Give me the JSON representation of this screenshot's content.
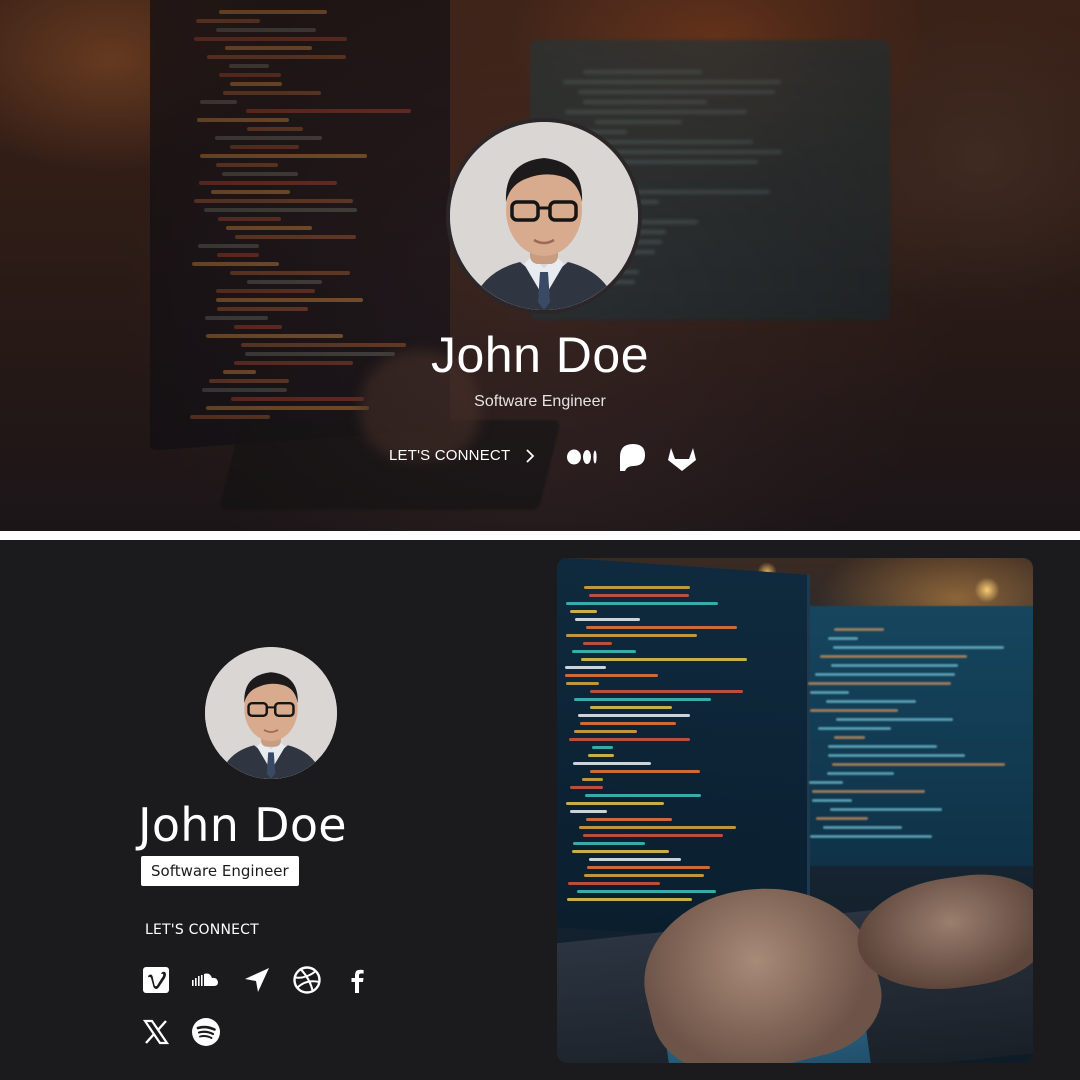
{
  "top_card": {
    "name": "John Doe",
    "title": "Software Engineer",
    "connect_label": "LET'S CONNECT",
    "social_icons": [
      "medium-icon",
      "patreon-icon",
      "gitlab-icon"
    ]
  },
  "bottom_card": {
    "name": "John Doe",
    "title": "Software Engineer",
    "connect_label": "LET'S CONNECT",
    "social_icons": [
      "vimeo-icon",
      "soundcloud-icon",
      "location-arrow-icon",
      "dribbble-icon",
      "facebook-icon",
      "x-twitter-icon",
      "spotify-icon"
    ]
  },
  "colors": {
    "bottom_background": "#1b1b1d",
    "text": "#ffffff",
    "title_badge_bg": "#ffffff"
  }
}
